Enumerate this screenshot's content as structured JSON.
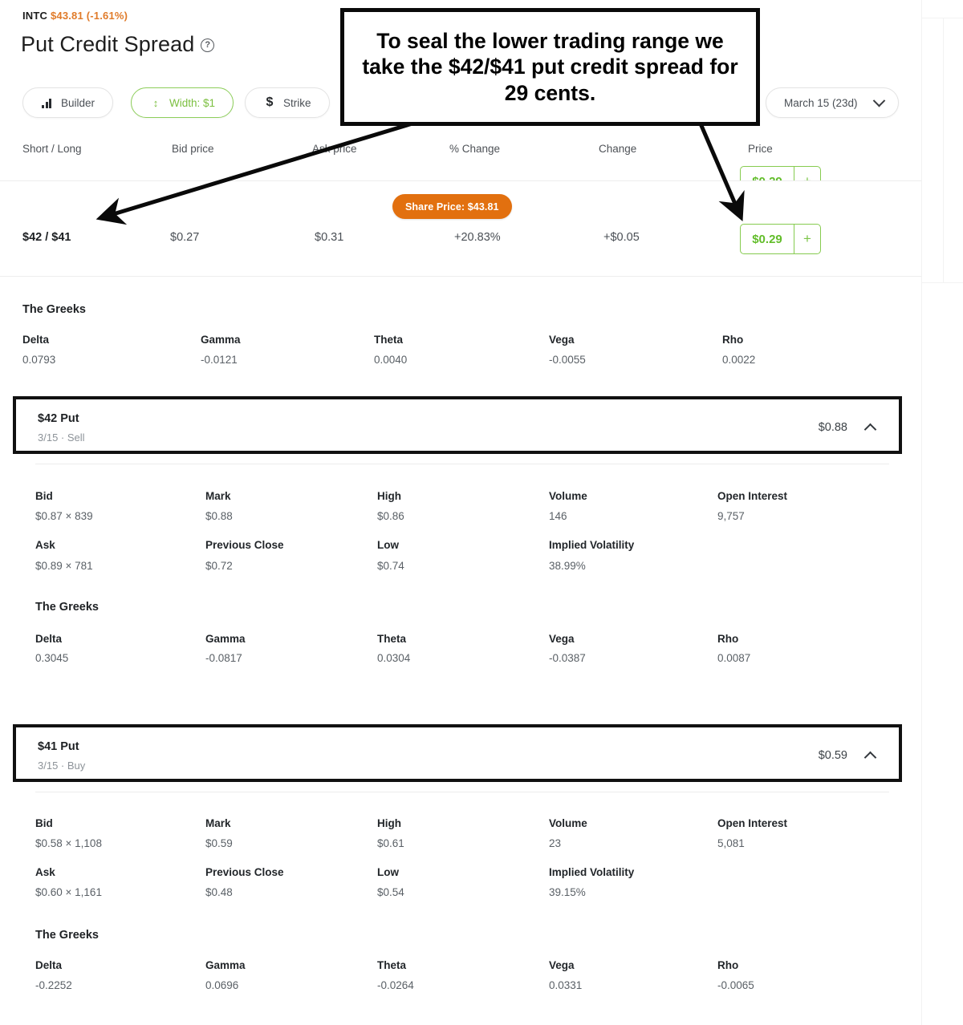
{
  "header": {
    "ticker_symbol": "INTC",
    "ticker_quote": "$43.81 (-1.61%)",
    "title": "Put Credit Spread",
    "info_icon": "question-circle-icon"
  },
  "toolbar": {
    "builder_label": "Builder",
    "width_label": "Width: $1",
    "strike_label": "Strike",
    "expiry_label": "March 15 (23d)",
    "builder_icon": "bar-chart-icon",
    "width_icon": "up-down-arrow-icon",
    "strike_icon": "dollar-icon",
    "expiry_icon": "chevron-down-icon"
  },
  "table": {
    "columns": [
      "Short / Long",
      "Bid price",
      "Ask price",
      "% Change",
      "Change",
      "Price"
    ],
    "share_price_badge": "Share Price: $43.81",
    "row": {
      "strikes": "$42 / $41",
      "bid_price": "$0.27",
      "ask_price": "$0.31",
      "percent_change": "+20.83%",
      "change": "+$0.05",
      "price": "$0.29",
      "add_button": "+"
    }
  },
  "spread_greeks": {
    "title": "The Greeks",
    "labels": [
      "Delta",
      "Gamma",
      "Theta",
      "Vega",
      "Rho"
    ],
    "values": [
      "0.0793",
      "-0.0121",
      "0.0040",
      "-0.0055",
      "0.0022"
    ]
  },
  "legs": [
    {
      "strike": "$42 Put",
      "sub": "3/15 · Sell",
      "price": "$0.88",
      "caret": "chevron-up-icon",
      "stats_row1": {
        "labels": [
          "Bid",
          "Mark",
          "High",
          "Volume",
          "Open Interest"
        ],
        "values": [
          "$0.87 × 839",
          "$0.88",
          "$0.86",
          "146",
          "9,757"
        ]
      },
      "stats_row2": {
        "labels": [
          "Ask",
          "Previous Close",
          "Low",
          "Implied Volatility"
        ],
        "values": [
          "$0.89 × 781",
          "$0.72",
          "$0.74",
          "38.99%"
        ]
      },
      "greeks": {
        "title": "The Greeks",
        "labels": [
          "Delta",
          "Gamma",
          "Theta",
          "Vega",
          "Rho"
        ],
        "values": [
          "0.3045",
          "-0.0817",
          "0.0304",
          "-0.0387",
          "0.0087"
        ]
      }
    },
    {
      "strike": "$41 Put",
      "sub": "3/15 · Buy",
      "price": "$0.59",
      "caret": "chevron-up-icon",
      "stats_row1": {
        "labels": [
          "Bid",
          "Mark",
          "High",
          "Volume",
          "Open Interest"
        ],
        "values": [
          "$0.58 × 1,108",
          "$0.59",
          "$0.61",
          "23",
          "5,081"
        ]
      },
      "stats_row2": {
        "labels": [
          "Ask",
          "Previous Close",
          "Low",
          "Implied Volatility"
        ],
        "values": [
          "$0.60 × 1,161",
          "$0.48",
          "$0.54",
          "39.15%"
        ]
      },
      "greeks": {
        "title": "The Greeks",
        "labels": [
          "Delta",
          "Gamma",
          "Theta",
          "Vega",
          "Rho"
        ],
        "values": [
          "-0.2252",
          "0.0696",
          "-0.0264",
          "0.0331",
          "-0.0065"
        ]
      }
    }
  ],
  "annotation": {
    "text": "To seal the lower trading range we take the $42/$41 put credit spread for 29 cents."
  },
  "colors": {
    "accent_green": "#62bd2a",
    "border_green": "#86cb4f",
    "orange_badge": "#e2700f",
    "ticker_orange": "#e07b2a",
    "annotation_black": "#0a0a0a"
  }
}
